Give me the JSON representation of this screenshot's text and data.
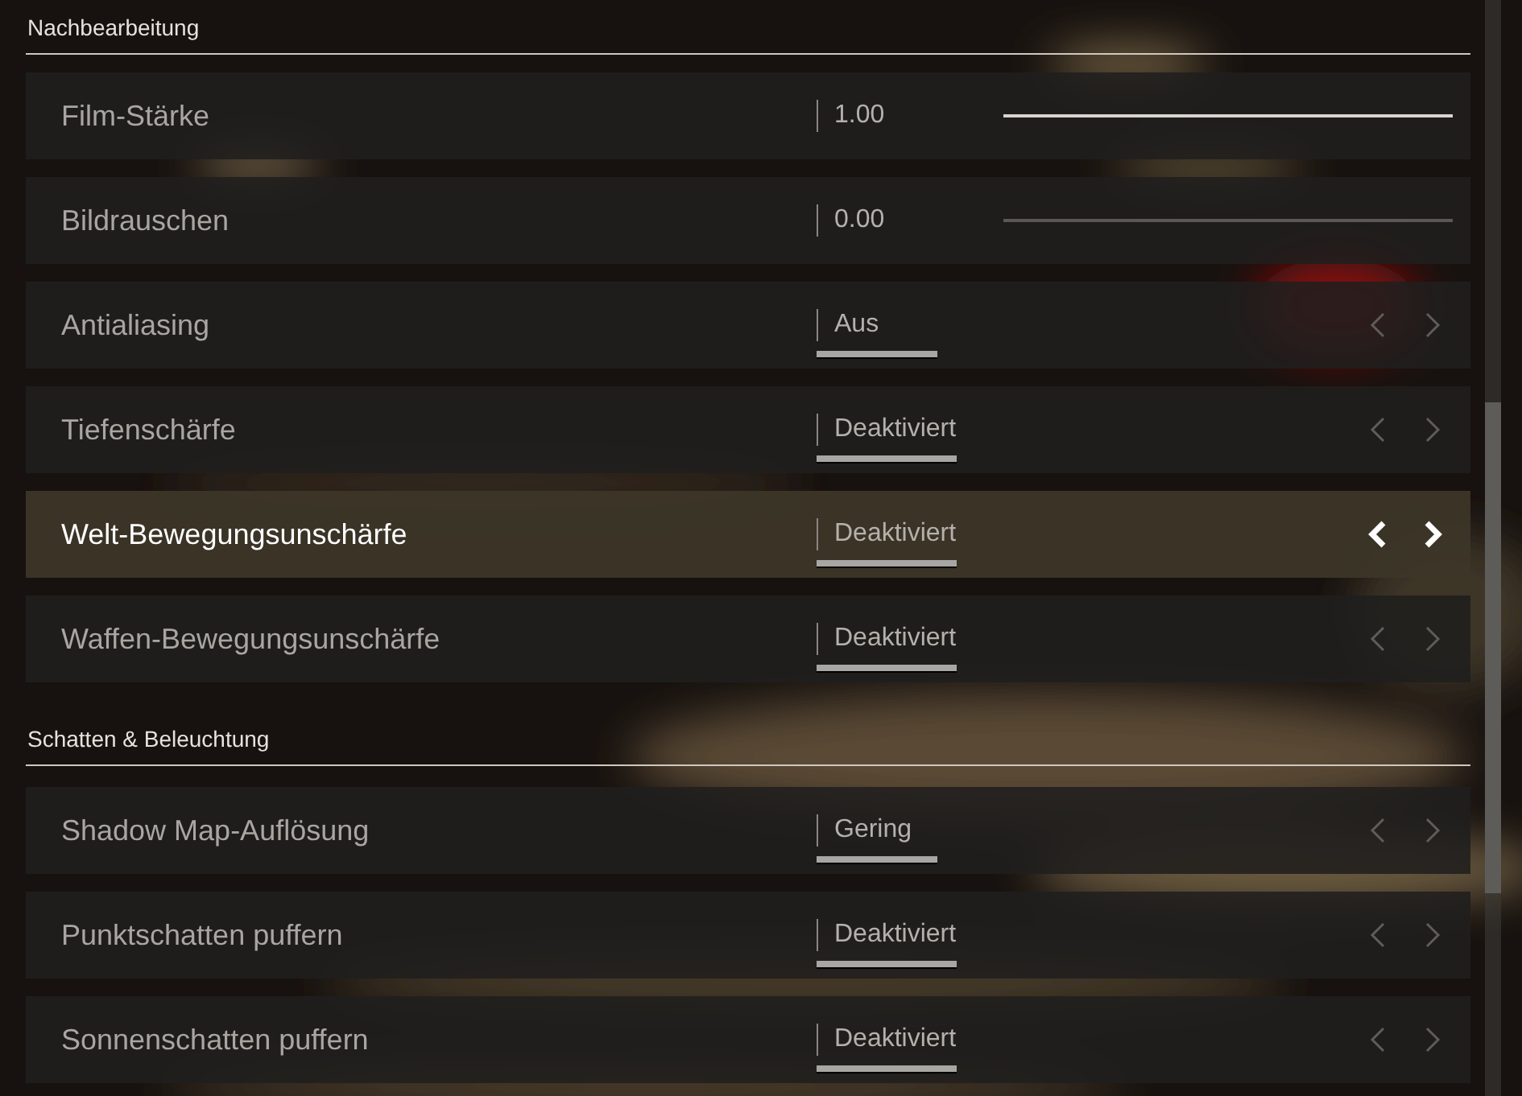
{
  "sections": [
    {
      "title": "Nachbearbeitung",
      "rows": [
        {
          "kind": "slider",
          "label": "Film-Stärke",
          "value": "1.00",
          "level": 1,
          "selected": false
        },
        {
          "kind": "slider",
          "label": "Bildrauschen",
          "value": "0.00",
          "selected": false
        },
        {
          "kind": "selector",
          "label": "Antialiasing",
          "value": "Aus",
          "selected": false
        },
        {
          "kind": "selector",
          "label": "Tiefenschärfe",
          "value": "Deaktiviert",
          "selected": false
        },
        {
          "kind": "selector",
          "label": "Welt-Bewegungsunschärfe",
          "value": "Deaktiviert",
          "selected": true
        },
        {
          "kind": "selector",
          "label": "Waffen-Bewegungsunschärfe",
          "value": "Deaktiviert",
          "selected": false
        }
      ]
    },
    {
      "title": "Schatten & Beleuchtung",
      "rows": [
        {
          "kind": "selector",
          "label": "Shadow Map-Auflösung",
          "value": "Gering",
          "selected": false
        },
        {
          "kind": "selector",
          "label": "Punktschatten puffern",
          "value": "Deaktiviert",
          "selected": false
        },
        {
          "kind": "selector",
          "label": "Sonnenschatten puffern",
          "value": "Deaktiviert",
          "selected": false
        }
      ]
    }
  ]
}
